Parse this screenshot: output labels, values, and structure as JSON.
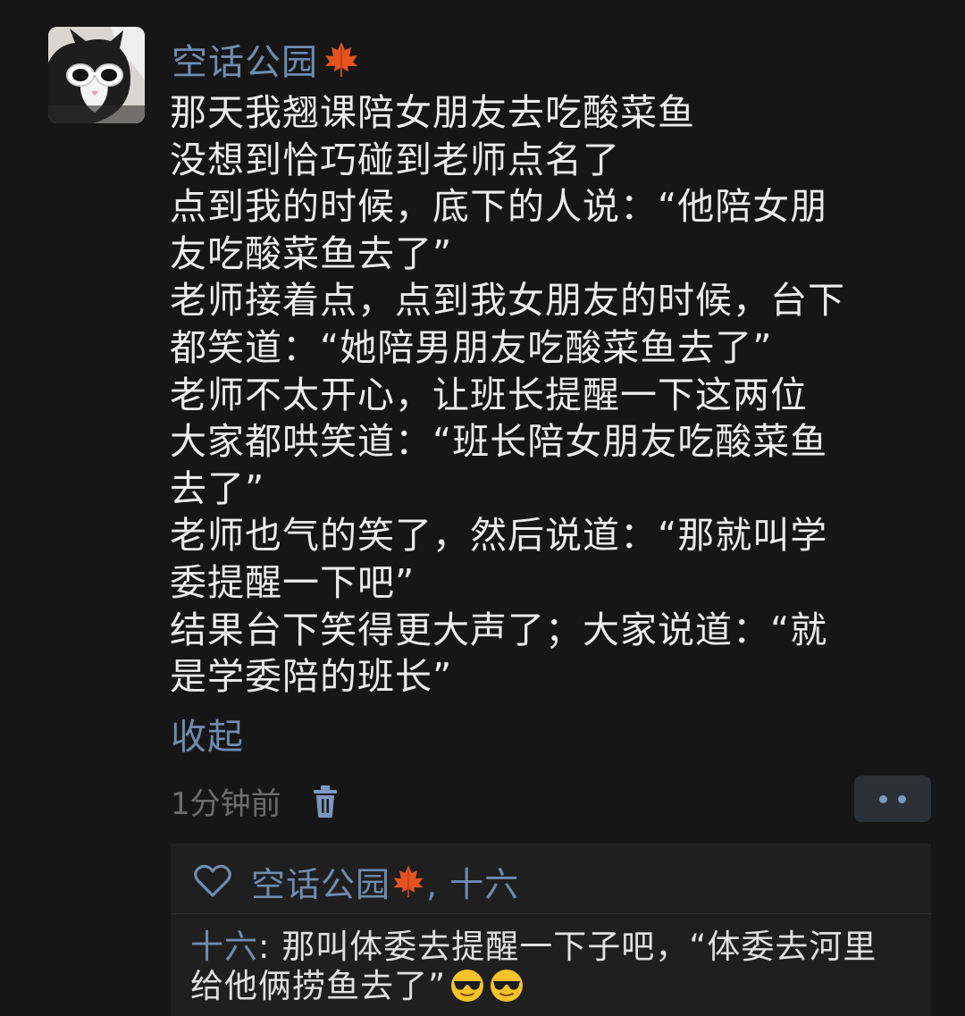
{
  "post": {
    "author": "空话公园",
    "author_icon": "maple-leaf-icon",
    "body_lines": [
      "那天我翘课陪女朋友去吃酸菜鱼",
      "没想到恰巧碰到老师点名了",
      "点到我的时候，底下的人说：“他陪女朋",
      "友吃酸菜鱼去了”",
      "老师接着点，点到我女朋友的时候，台下",
      "都笑道：“她陪男朋友吃酸菜鱼去了”",
      "老师不太开心，让班长提醒一下这两位",
      "大家都哄笑道：“班长陪女朋友吃酸菜鱼",
      "去了”",
      "老师也气的笑了，然后说道：“那就叫学",
      "委提醒一下吧”",
      "结果台下笑得更大声了；大家说道：“就",
      "是学委陪的班长”"
    ],
    "collapse_label": "收起",
    "timestamp": "1分钟前",
    "delete_icon": "trash-icon",
    "more_icon": "more-dots-icon"
  },
  "interactions": {
    "like_icon": "heart-icon",
    "likers": "空话公园",
    "likers_rest": ", 十六",
    "comment": {
      "commenter": "十六",
      "separator": ": ",
      "line1": "那叫体委去提醒一下子吧，“体委去河里",
      "line2": "给他俩捞鱼去了”",
      "emojis": [
        "sunglasses-emoji",
        "sunglasses-emoji"
      ]
    }
  },
  "colors": {
    "background": "#161616",
    "link_blue": "#6f8cb0",
    "body_text": "#ececec",
    "muted": "#6d6d6d",
    "panel": "#1f1f1f"
  }
}
